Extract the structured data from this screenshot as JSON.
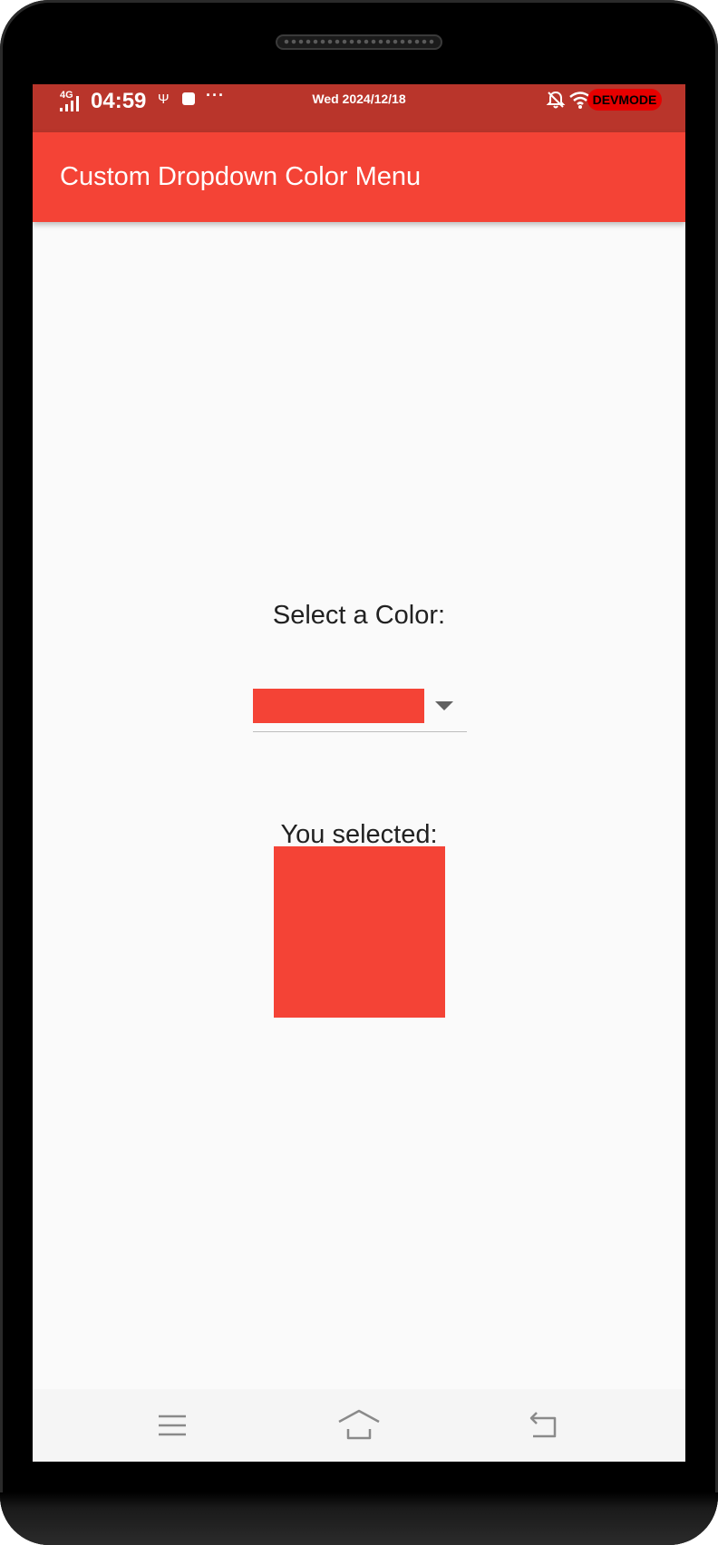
{
  "status_bar": {
    "network": "4G",
    "time": "04:59",
    "more": "···",
    "date": "Wed 2024/12/18",
    "dev_badge": "DEVMODE"
  },
  "app_bar": {
    "title": "Custom Dropdown Color Menu"
  },
  "main": {
    "select_label": "Select a Color:",
    "dropdown": {
      "selected_color": "#f44336"
    },
    "selected_label": "You selected:",
    "selected_color": "#f44336"
  },
  "navigation": {
    "items": [
      "menu-icon",
      "home-icon",
      "back-icon"
    ]
  },
  "colors": {
    "accent": "#f44336",
    "status_bar": "#b9352b",
    "background": "#fafafa",
    "text": "#212121"
  }
}
